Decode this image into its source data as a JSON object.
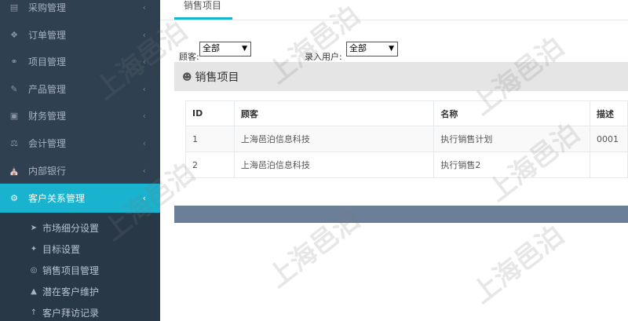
{
  "sidebar": {
    "items": [
      {
        "icon": "list-icon",
        "label": "采购管理"
      },
      {
        "icon": "cart-icon",
        "label": "订单管理"
      },
      {
        "icon": "link-icon",
        "label": "项目管理"
      },
      {
        "icon": "edit-icon",
        "label": "产品管理"
      },
      {
        "icon": "money-icon",
        "label": "财务管理"
      },
      {
        "icon": "scale-icon",
        "label": "会计管理"
      },
      {
        "icon": "bank-icon",
        "label": "内部银行"
      },
      {
        "icon": "cogs-icon",
        "label": "客户关系管理"
      }
    ],
    "active_index": 7,
    "submenu": [
      {
        "icon": "send-icon",
        "label": "市场细分设置"
      },
      {
        "icon": "crosshair-icon",
        "label": "目标设置"
      },
      {
        "icon": "circle-icon",
        "label": "销售项目管理"
      },
      {
        "icon": "binoculars-icon",
        "label": "潜在客户维护"
      },
      {
        "icon": "pin-icon",
        "label": "客户拜访记录"
      }
    ]
  },
  "tabs": [
    {
      "label": "销售项目"
    }
  ],
  "filters": {
    "customer": {
      "label": "顾客:",
      "value": "全部"
    },
    "user": {
      "label": "录入用户:",
      "value": "全部"
    }
  },
  "panel": {
    "title": "销售项目",
    "icon": "user-icon"
  },
  "table": {
    "columns": [
      "ID",
      "顾客",
      "名称",
      "描述"
    ],
    "rows": [
      [
        "1",
        "上海邑泊信息科技",
        "执行销售计划",
        "0001"
      ],
      [
        "2",
        "上海邑泊信息科技",
        "执行销售2",
        ""
      ]
    ]
  },
  "watermark": {
    "text": "上海邑泊"
  },
  "colors": {
    "sidebar": "#2f4050",
    "accent": "#1ab3cf",
    "footer": "#6b7f99"
  }
}
